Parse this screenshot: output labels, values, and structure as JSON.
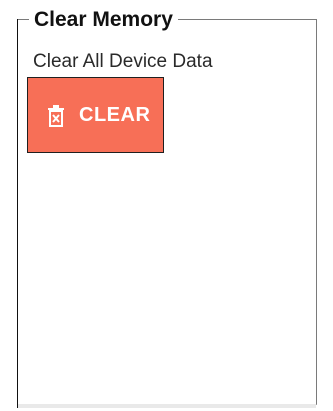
{
  "panel": {
    "title": "Clear Memory",
    "description": "Clear All Device Data"
  },
  "clear_button": {
    "label": "CLEAR",
    "icon": "trash-x-icon",
    "background": "#f76f57",
    "text_color": "#ffffff"
  }
}
